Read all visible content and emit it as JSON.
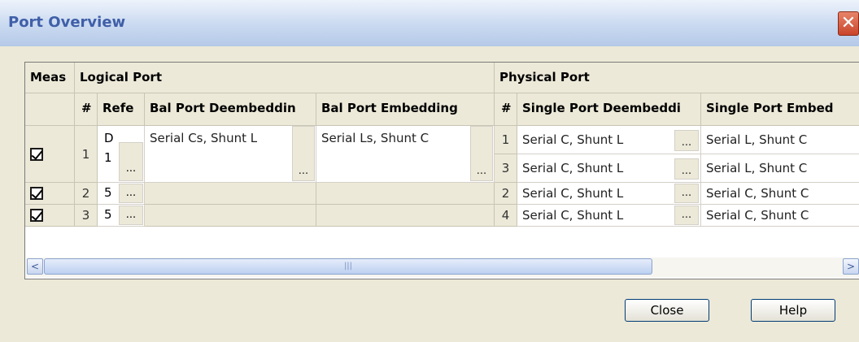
{
  "window": {
    "title": "Port Overview",
    "close_glyph": "✕"
  },
  "groups": {
    "meas": "Meas",
    "logical": "Logical Port",
    "physical": "Physical Port"
  },
  "columns": {
    "index": "#",
    "reference": "Refe",
    "bal_deembed": "Bal Port Deembeddin",
    "bal_embed": "Bal Port Embedding",
    "phys_index": "#",
    "single_deembed": "Single Port Deembeddi",
    "single_embed": "Single Port Embed"
  },
  "ellipsis": "...",
  "logical_rows": [
    {
      "meas": true,
      "index": "1",
      "ref_line1": "D",
      "ref_line2": "1",
      "bal_deembed": "Serial Cs, Shunt L",
      "bal_embed": "Serial Ls, Shunt C"
    },
    {
      "meas": true,
      "index": "2",
      "ref_line1": "5",
      "ref_line2": "",
      "bal_deembed": "",
      "bal_embed": ""
    },
    {
      "meas": true,
      "index": "3",
      "ref_line1": "5",
      "ref_line2": "",
      "bal_deembed": "",
      "bal_embed": ""
    }
  ],
  "physical_rows": [
    {
      "index": "1",
      "deembed": "Serial C, Shunt L",
      "embed": "Serial L, Shunt C"
    },
    {
      "index": "3",
      "deembed": "Serial C, Shunt L",
      "embed": "Serial L, Shunt C"
    },
    {
      "index": "2",
      "deembed": "Serial C, Shunt L",
      "embed": "Serial C, Shunt C"
    },
    {
      "index": "4",
      "deembed": "Serial C, Shunt L",
      "embed": "Serial C, Shunt C"
    }
  ],
  "scrollbar": {
    "left_arrow": "<",
    "right_arrow": ">",
    "grip": "|||"
  },
  "buttons": {
    "close": "Close",
    "help": "Help"
  }
}
